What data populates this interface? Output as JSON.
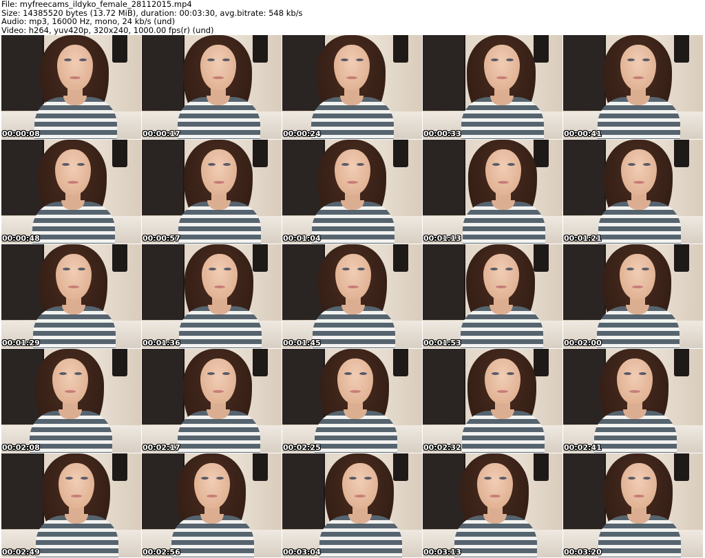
{
  "header": {
    "file_line": "File: myfreecams_ildyko_female_28112015.mp4",
    "size_line": "Size: 14385520 bytes (13.72 MiB), duration: 00:03:30, avg.bitrate: 548 kb/s",
    "audio_line": "Audio: mp3, 16000 Hz, mono, 24 kb/s (und)",
    "video_line": "Video: h264, yuv420p, 320x240, 1000.00 fps(r) (und)"
  },
  "thumbnails": [
    {
      "timestamp": "00:00:08"
    },
    {
      "timestamp": "00:00:17"
    },
    {
      "timestamp": "00:00:24"
    },
    {
      "timestamp": "00:00:33"
    },
    {
      "timestamp": "00:00:41"
    },
    {
      "timestamp": "00:00:48"
    },
    {
      "timestamp": "00:00:57"
    },
    {
      "timestamp": "00:01:04"
    },
    {
      "timestamp": "00:01:13"
    },
    {
      "timestamp": "00:01:21"
    },
    {
      "timestamp": "00:01:29"
    },
    {
      "timestamp": "00:01:36"
    },
    {
      "timestamp": "00:01:45"
    },
    {
      "timestamp": "00:01:53"
    },
    {
      "timestamp": "00:02:00"
    },
    {
      "timestamp": "00:02:08"
    },
    {
      "timestamp": "00:02:17"
    },
    {
      "timestamp": "00:02:25"
    },
    {
      "timestamp": "00:02:32"
    },
    {
      "timestamp": "00:02:41"
    },
    {
      "timestamp": "00:02:49"
    },
    {
      "timestamp": "00:02:56"
    },
    {
      "timestamp": "00:03:04"
    },
    {
      "timestamp": "00:03:13"
    },
    {
      "timestamp": "00:03:20"
    }
  ]
}
